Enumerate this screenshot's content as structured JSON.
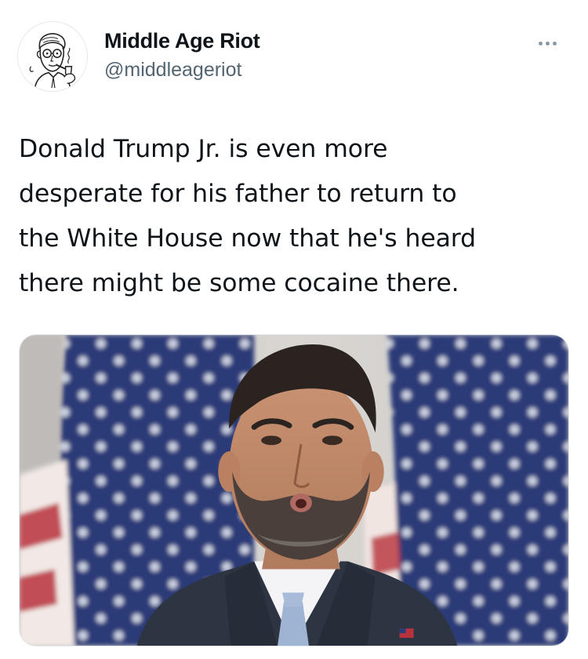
{
  "tweet": {
    "author": {
      "display_name": "Middle Age Riot",
      "handle": "@middleageriot",
      "avatar_icon": "vintage-man-with-pipe-icon"
    },
    "more_icon": "more-horizontal-icon",
    "text": "Donald Trump Jr. is even more\ndesperate for his father to return to\nthe White House now that he's heard\nthere might be some cocaine there.",
    "media": {
      "type": "photo"
    }
  },
  "colors": {
    "text_primary": "#0f1419",
    "text_secondary": "#536471",
    "background": "#ffffff",
    "flag_blue": "#2b3a78",
    "flag_red": "#b8323c"
  }
}
